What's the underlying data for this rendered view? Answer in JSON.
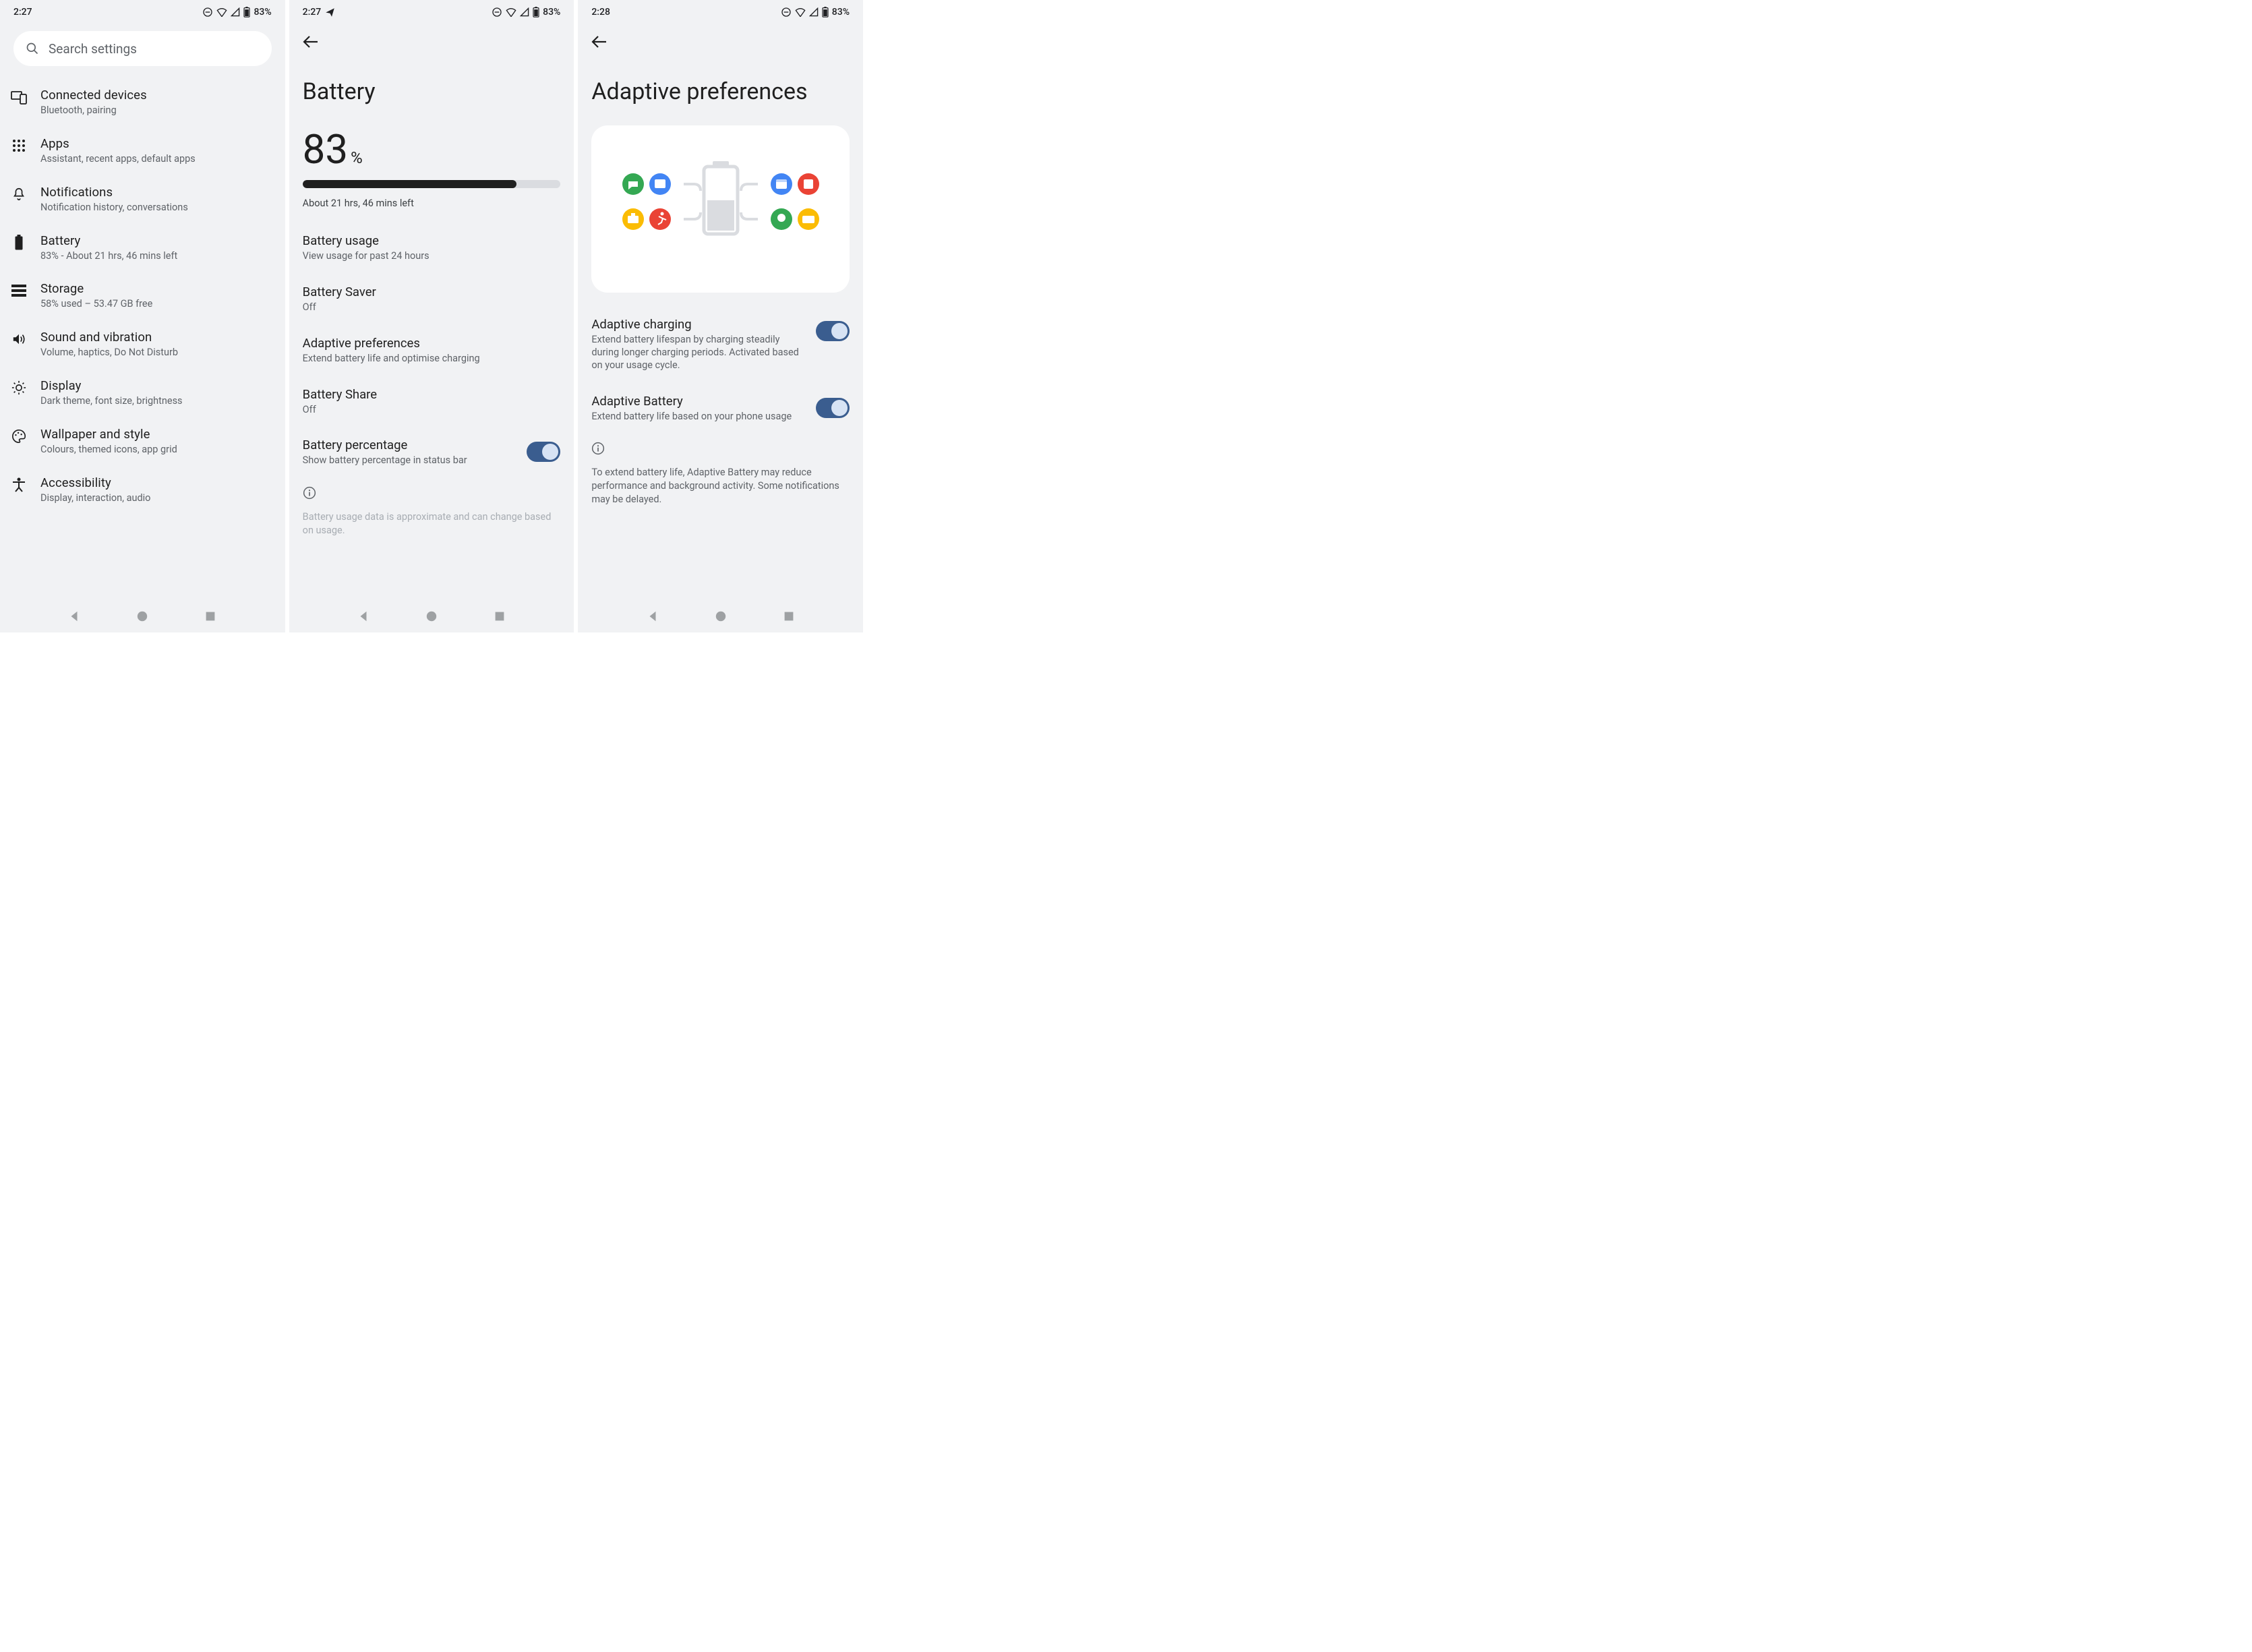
{
  "screen1": {
    "status": {
      "time": "2:27",
      "battery_pct": "83%"
    },
    "search": {
      "placeholder": "Search settings"
    },
    "items": [
      {
        "icon": "devices",
        "title": "Connected devices",
        "subtitle": "Bluetooth, pairing"
      },
      {
        "icon": "apps",
        "title": "Apps",
        "subtitle": "Assistant, recent apps, default apps"
      },
      {
        "icon": "bell",
        "title": "Notifications",
        "subtitle": "Notification history, conversations"
      },
      {
        "icon": "battery",
        "title": "Battery",
        "subtitle": "83% - About 21 hrs, 46 mins left"
      },
      {
        "icon": "storage",
        "title": "Storage",
        "subtitle": "58% used – 53.47 GB free"
      },
      {
        "icon": "sound",
        "title": "Sound and vibration",
        "subtitle": "Volume, haptics, Do Not Disturb"
      },
      {
        "icon": "display",
        "title": "Display",
        "subtitle": "Dark theme, font size, brightness"
      },
      {
        "icon": "palette",
        "title": "Wallpaper and style",
        "subtitle": "Colours, themed icons, app grid"
      },
      {
        "icon": "accessibility",
        "title": "Accessibility",
        "subtitle": "Display, interaction, audio"
      }
    ]
  },
  "screen2": {
    "status": {
      "time": "2:27",
      "battery_pct": "83%"
    },
    "title": "Battery",
    "percent": "83",
    "percent_suffix": "%",
    "progress": 83,
    "estimate": "About 21 hrs, 46 mins left",
    "rows": [
      {
        "title": "Battery usage",
        "subtitle": "View usage for past 24 hours"
      },
      {
        "title": "Battery Saver",
        "subtitle": "Off"
      },
      {
        "title": "Adaptive preferences",
        "subtitle": "Extend battery life and optimise charging"
      },
      {
        "title": "Battery Share",
        "subtitle": "Off"
      },
      {
        "title": "Battery percentage",
        "subtitle": "Show battery percentage in status bar",
        "toggle": true
      }
    ],
    "info": "Battery usage data is approximate and can change based on usage."
  },
  "screen3": {
    "status": {
      "time": "2:28",
      "battery_pct": "83%"
    },
    "title": "Adaptive preferences",
    "rows": [
      {
        "title": "Adaptive charging",
        "subtitle": "Extend battery lifespan by charging steadily during longer charging periods. Activated based on your usage cycle.",
        "toggle": true
      },
      {
        "title": "Adaptive Battery",
        "subtitle": "Extend battery life based on your phone usage",
        "toggle": true
      }
    ],
    "info": "To extend battery life, Adaptive Battery may reduce performance and background activity. Some notifications may be delayed.",
    "hero_colors": {
      "green": "#34a853",
      "blue": "#4285f4",
      "yellow": "#fbbc04",
      "red": "#ea4335",
      "grey": "#dadce0"
    }
  }
}
